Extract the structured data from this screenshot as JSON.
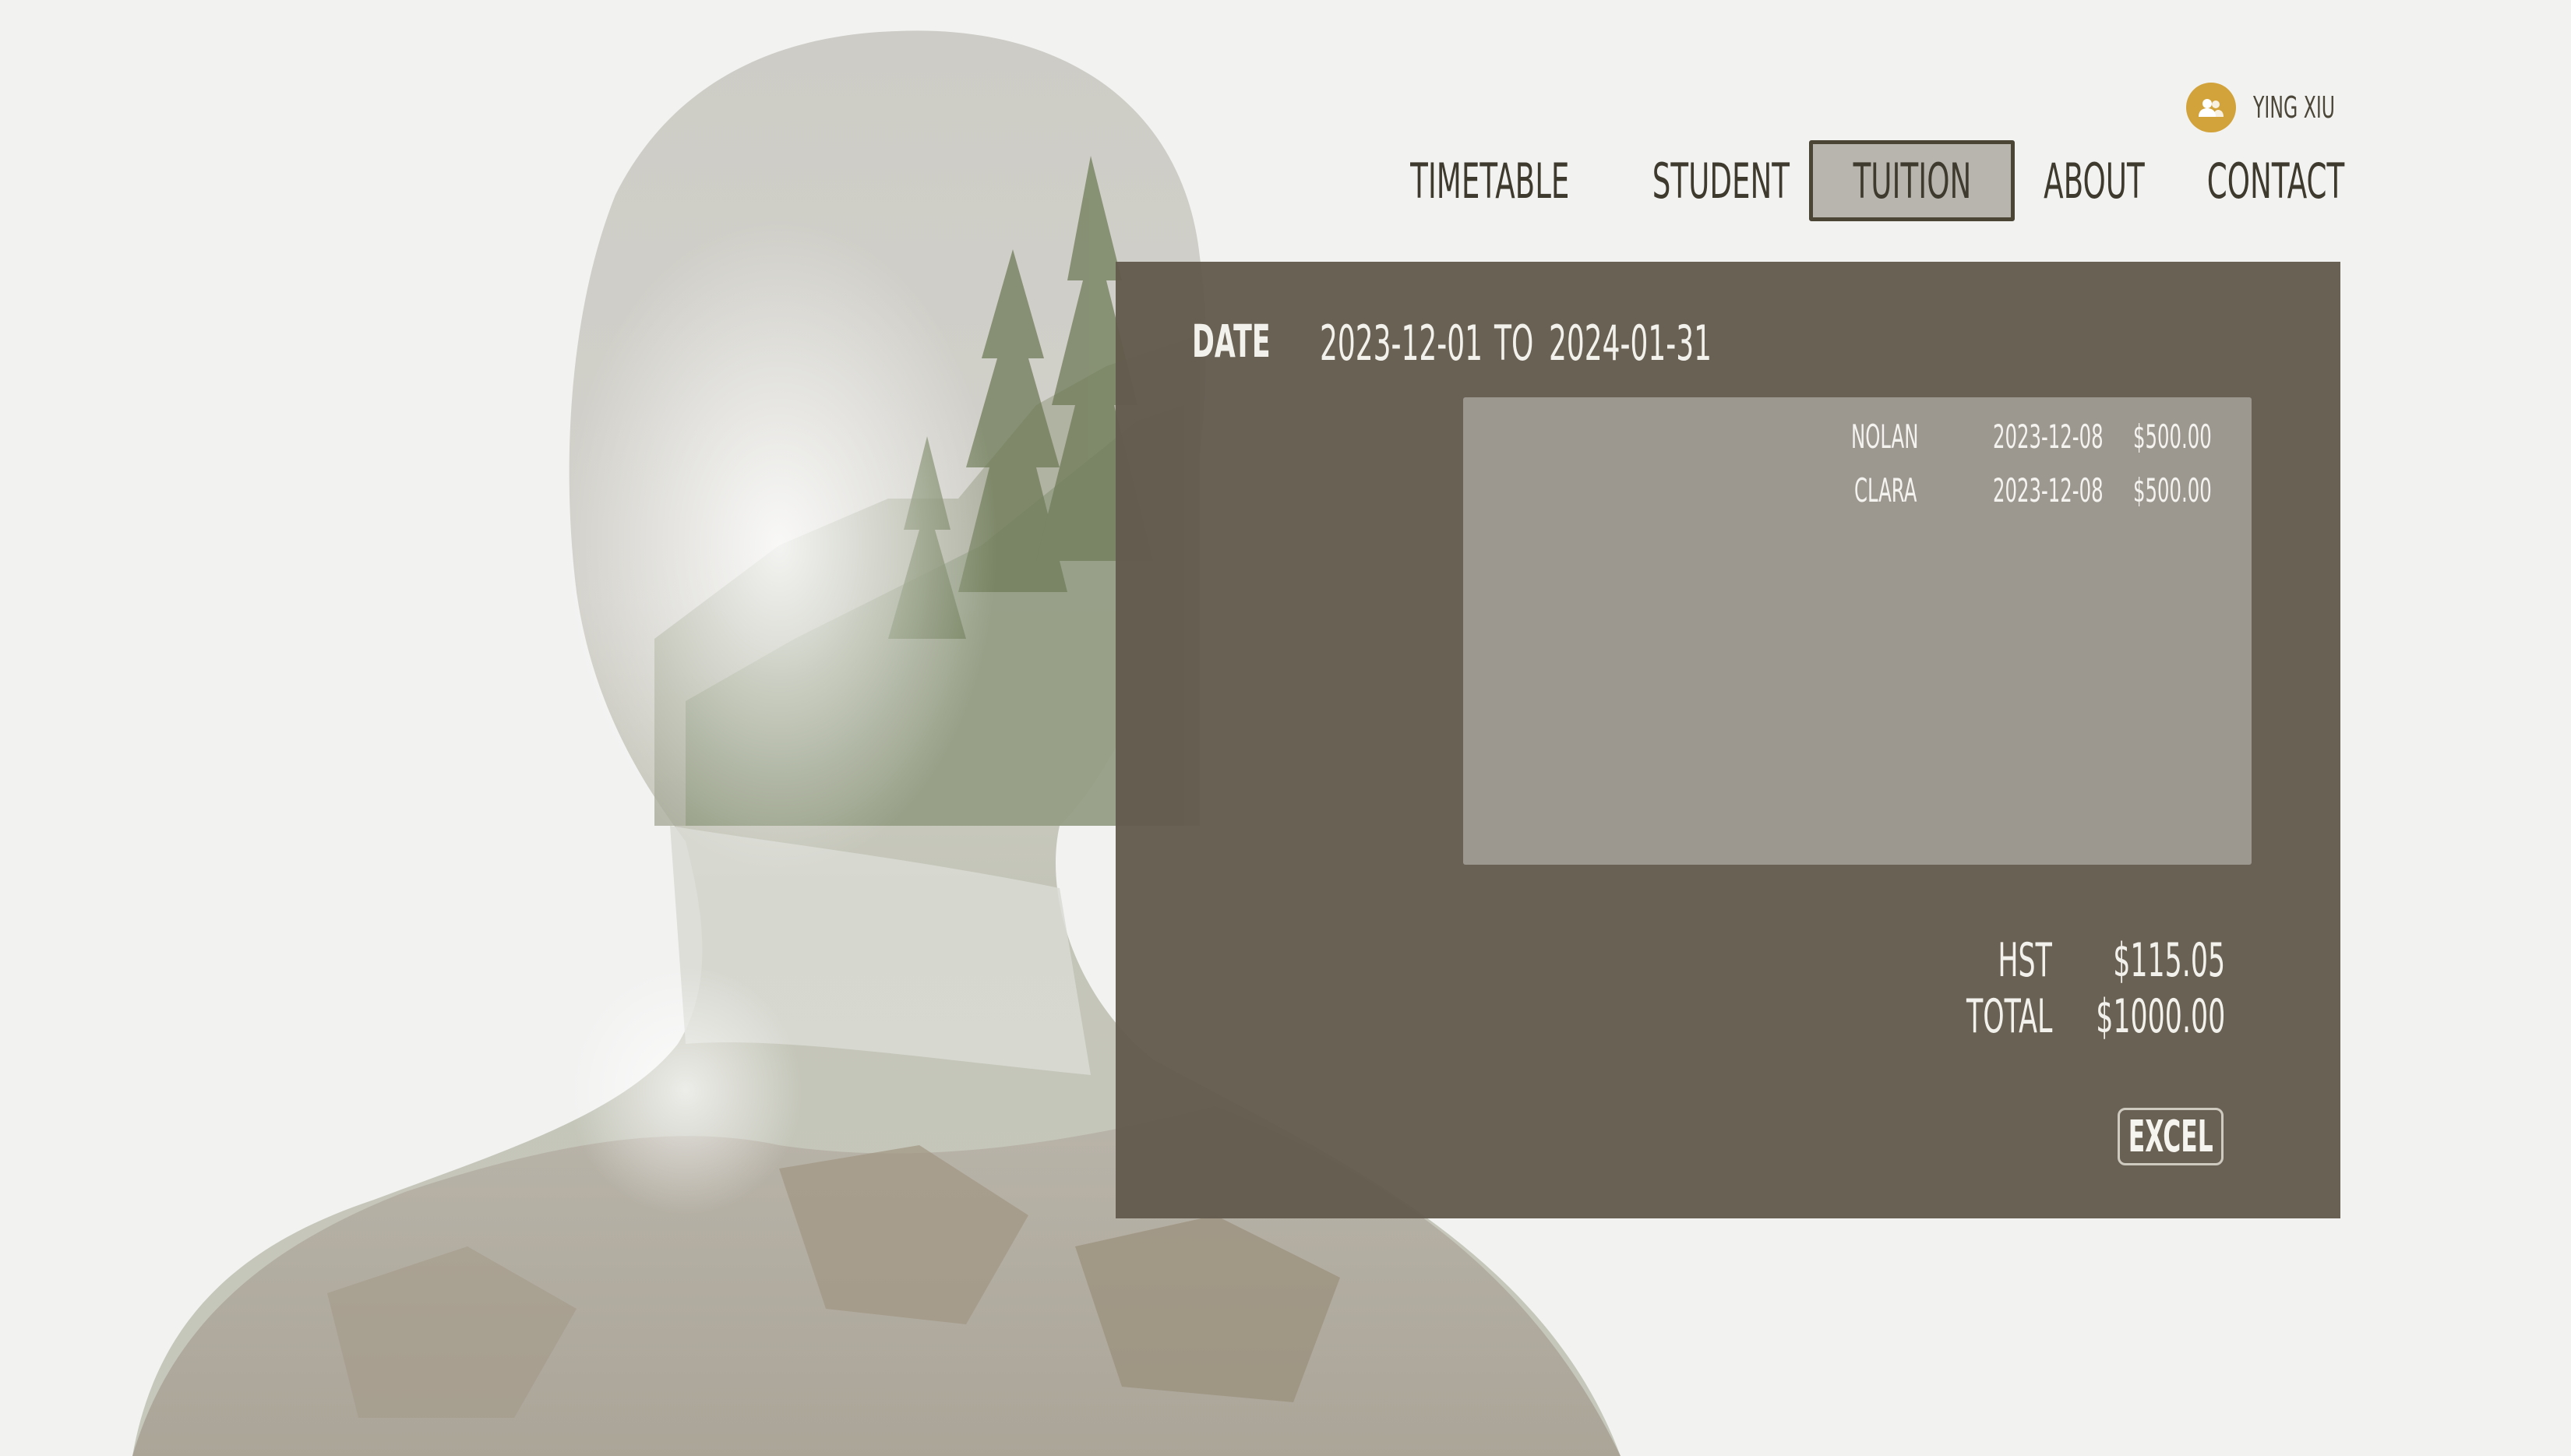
{
  "user": {
    "name": "YING XIU",
    "avatar_icon": "users-icon",
    "avatar_color": "#d2a33a"
  },
  "nav": {
    "items": [
      {
        "label": "TIMETABLE",
        "active": false
      },
      {
        "label": "STUDENT",
        "active": false
      },
      {
        "label": "TUITION",
        "active": true
      },
      {
        "label": "ABOUT",
        "active": false
      },
      {
        "label": "CONTACT",
        "active": false
      }
    ]
  },
  "tuition": {
    "date_label": "DATE",
    "date_from": "2023-12-01",
    "date_to_word": "TO",
    "date_to": "2024-01-31",
    "records": [
      {
        "student": "NOLAN",
        "date": "2023-12-08",
        "amount": "$500.00"
      },
      {
        "student": "CLARA",
        "date": "2023-12-08",
        "amount": "$500.00"
      }
    ],
    "hst_label": "HST",
    "hst_value": "$115.05",
    "total_label": "TOTAL",
    "total_value": "$1000.00",
    "export_label": "EXCEL"
  },
  "colors": {
    "panel_bg": "#635b4d",
    "list_bg": "#9c9890",
    "nav_text": "#3f3a2e",
    "active_tab_bg": "#b8b5af",
    "page_bg": "#f2f2f1"
  }
}
